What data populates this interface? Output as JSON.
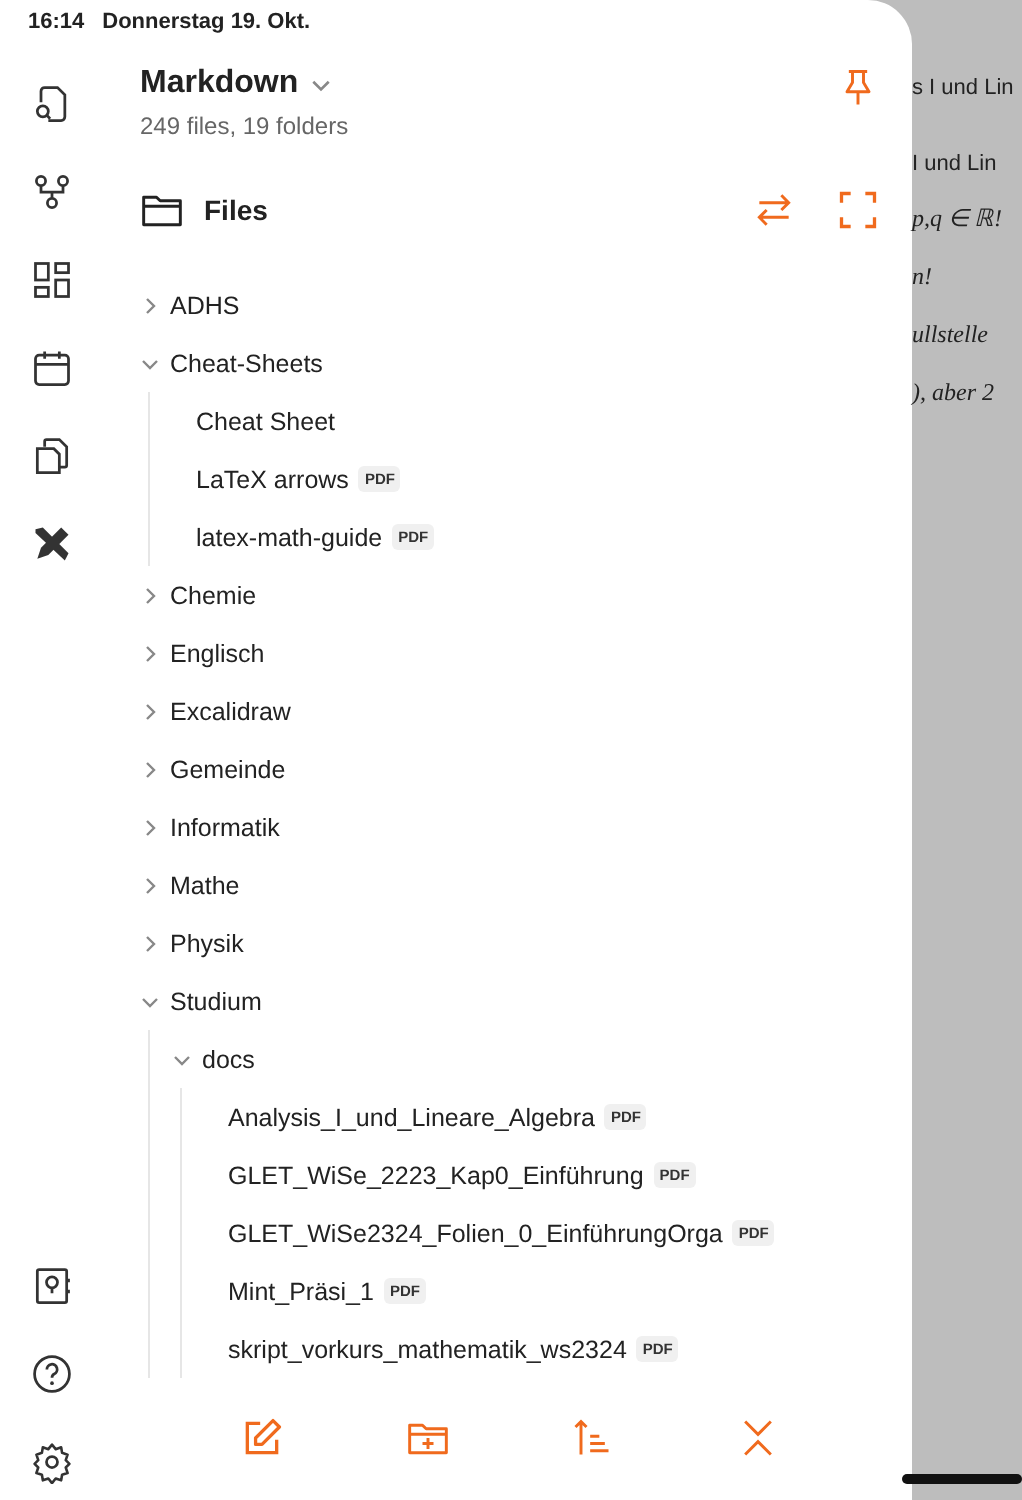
{
  "status_bar": {
    "time": "16:14",
    "date": "Donnerstag 19. Okt."
  },
  "vault": {
    "name": "Markdown",
    "stats": "249 files, 19 folders",
    "pinned": true
  },
  "section": {
    "title": "Files"
  },
  "tree": [
    {
      "kind": "folder",
      "name": "ADHS",
      "expanded": false
    },
    {
      "kind": "folder",
      "name": "Cheat-Sheets",
      "expanded": true,
      "children": [
        {
          "kind": "file",
          "name": "Cheat Sheet"
        },
        {
          "kind": "file",
          "name": "LaTeX arrows",
          "badge": "PDF"
        },
        {
          "kind": "file",
          "name": "latex-math-guide",
          "badge": "PDF"
        }
      ]
    },
    {
      "kind": "folder",
      "name": "Chemie",
      "expanded": false
    },
    {
      "kind": "folder",
      "name": "Englisch",
      "expanded": false
    },
    {
      "kind": "folder",
      "name": "Excalidraw",
      "expanded": false
    },
    {
      "kind": "folder",
      "name": "Gemeinde",
      "expanded": false
    },
    {
      "kind": "folder",
      "name": "Informatik",
      "expanded": false
    },
    {
      "kind": "folder",
      "name": "Mathe",
      "expanded": false
    },
    {
      "kind": "folder",
      "name": "Physik",
      "expanded": false
    },
    {
      "kind": "folder",
      "name": "Studium",
      "expanded": true,
      "children": [
        {
          "kind": "folder",
          "name": "docs",
          "expanded": true,
          "children": [
            {
              "kind": "file",
              "name": "Analysis_I_und_Lineare_Algebra",
              "badge": "PDF"
            },
            {
              "kind": "file",
              "name": "GLET_WiSe_2223_Kap0_Einführung",
              "badge": "PDF"
            },
            {
              "kind": "file",
              "name": "GLET_WiSe2324_Folien_0_EinführungOrga",
              "badge": "PDF"
            },
            {
              "kind": "file",
              "name": "Mint_Präsi_1",
              "badge": "PDF"
            },
            {
              "kind": "file",
              "name": "skript_vorkurs_mathematik_ws2324",
              "badge": "PDF"
            }
          ]
        }
      ]
    }
  ],
  "background_document": {
    "tab_title": "s I und Lin",
    "heading": "I und Lin",
    "notes": [
      "p,q ∈ ℝ!",
      "n!",
      "ullstelle",
      "), aber 2"
    ]
  }
}
